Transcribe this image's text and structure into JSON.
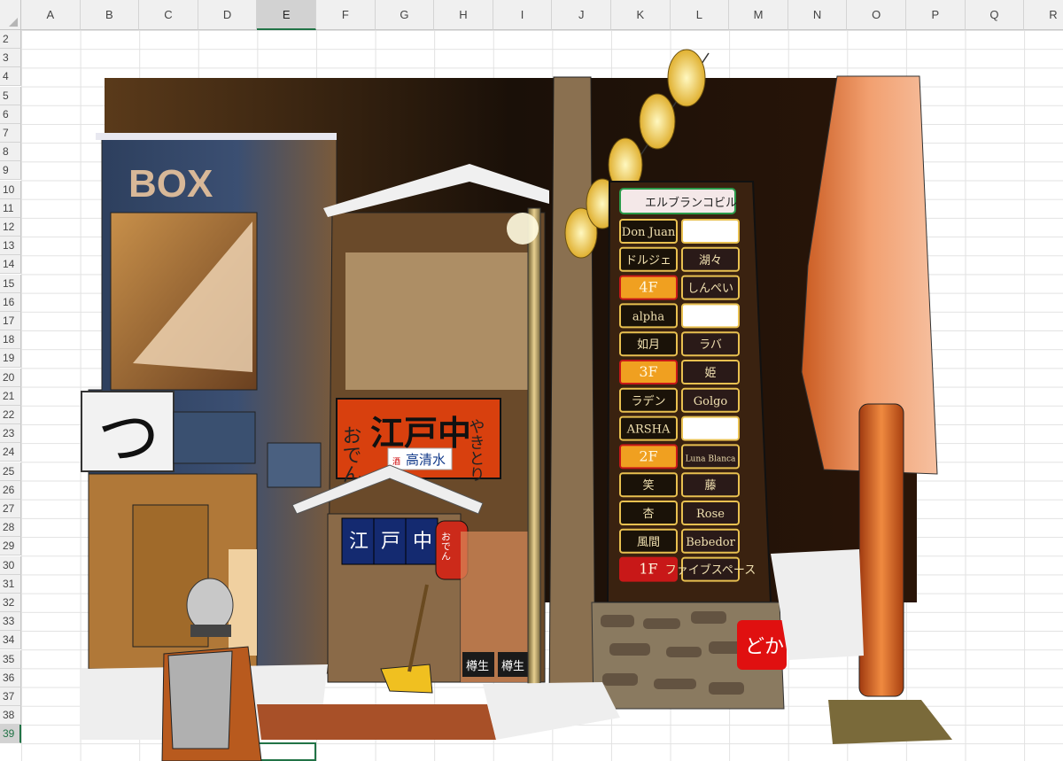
{
  "spreadsheet": {
    "columns": [
      "A",
      "B",
      "C",
      "D",
      "E",
      "F",
      "G",
      "H",
      "I",
      "J",
      "K",
      "L",
      "M",
      "N",
      "O",
      "P",
      "Q",
      "R"
    ],
    "rows": [
      "2",
      "3",
      "4",
      "5",
      "6",
      "7",
      "8",
      "9",
      "10",
      "11",
      "12",
      "13",
      "14",
      "15",
      "16",
      "17",
      "18",
      "19",
      "20",
      "21",
      "22",
      "23",
      "24",
      "25",
      "26",
      "27",
      "28",
      "29",
      "30",
      "31",
      "32",
      "33",
      "34",
      "35",
      "36",
      "37",
      "38",
      "39"
    ],
    "selected_column": "E",
    "selected_row": "39"
  },
  "illustration": {
    "box_building_sign": "BOX",
    "small_sign_char": "つ",
    "izakaya": {
      "left_text": "おでん",
      "main_text": "江戸中",
      "right_text": "やきとり",
      "sub_text": "高清水",
      "sub_prefix": "酒",
      "noren": [
        "江",
        "戸",
        "中"
      ],
      "lantern_text": "おでん",
      "barrel_label": "樽生"
    },
    "tenant_board": {
      "building_name": "エルブランコビル",
      "signs": [
        [
          "Don Juan",
          ""
        ],
        [
          "ドルジェ",
          "湖々"
        ],
        [
          "4F",
          "しんぺい"
        ],
        [
          "alpha",
          ""
        ],
        [
          "如月",
          "ラバ"
        ],
        [
          "3F",
          "姫"
        ],
        [
          "ラデン",
          "Golgo"
        ],
        [
          "ARSHA",
          ""
        ],
        [
          "2F",
          "Luna Blanca"
        ],
        [
          "笑",
          "藤"
        ],
        [
          "杏",
          "Rose"
        ],
        [
          "風間",
          "Bebedor"
        ],
        [
          "1F",
          "ファイブスペース"
        ]
      ]
    },
    "red_square_sign": "どか"
  }
}
